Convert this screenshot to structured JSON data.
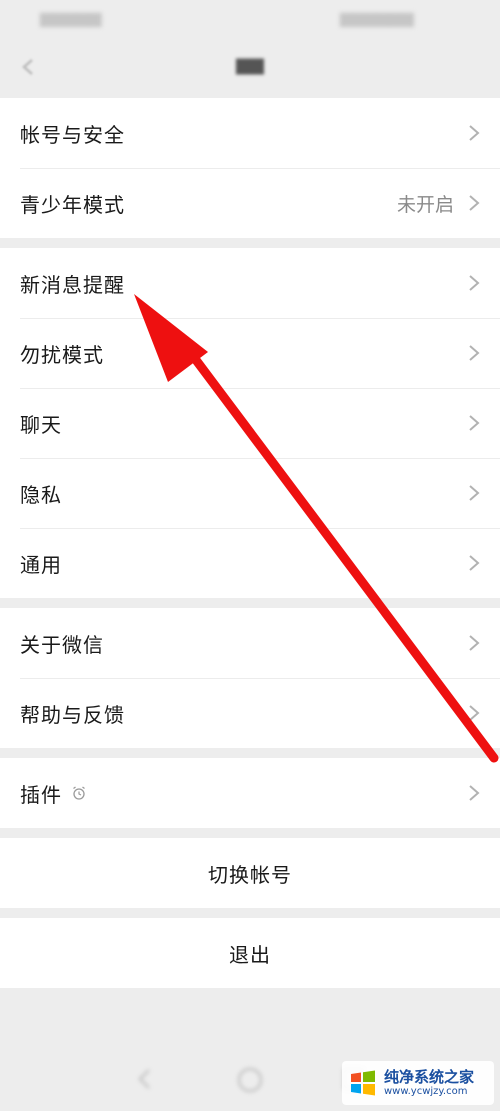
{
  "groups": [
    {
      "items": [
        {
          "label": "帐号与安全",
          "value": ""
        },
        {
          "label": "青少年模式",
          "value": "未开启"
        }
      ]
    },
    {
      "items": [
        {
          "label": "新消息提醒",
          "value": ""
        },
        {
          "label": "勿扰模式",
          "value": ""
        },
        {
          "label": "聊天",
          "value": ""
        },
        {
          "label": "隐私",
          "value": ""
        },
        {
          "label": "通用",
          "value": ""
        }
      ]
    },
    {
      "items": [
        {
          "label": "关于微信",
          "value": ""
        },
        {
          "label": "帮助与反馈",
          "value": ""
        }
      ]
    },
    {
      "items": [
        {
          "label": "插件",
          "value": "",
          "icon": "alarm-icon"
        }
      ]
    }
  ],
  "actions": {
    "switch_account": "切换帐号",
    "logout": "退出"
  },
  "watermark": {
    "title": "纯净系统之家",
    "url": "www.ycwjzy.com"
  },
  "colors": {
    "background": "#ededed",
    "surface": "#ffffff",
    "text": "#1a1a1a",
    "secondary_text": "#8a8a8a",
    "chevron": "#b2b2b2",
    "annotation_arrow": "#ee1010",
    "watermark_blue": "#1a4fa0"
  }
}
